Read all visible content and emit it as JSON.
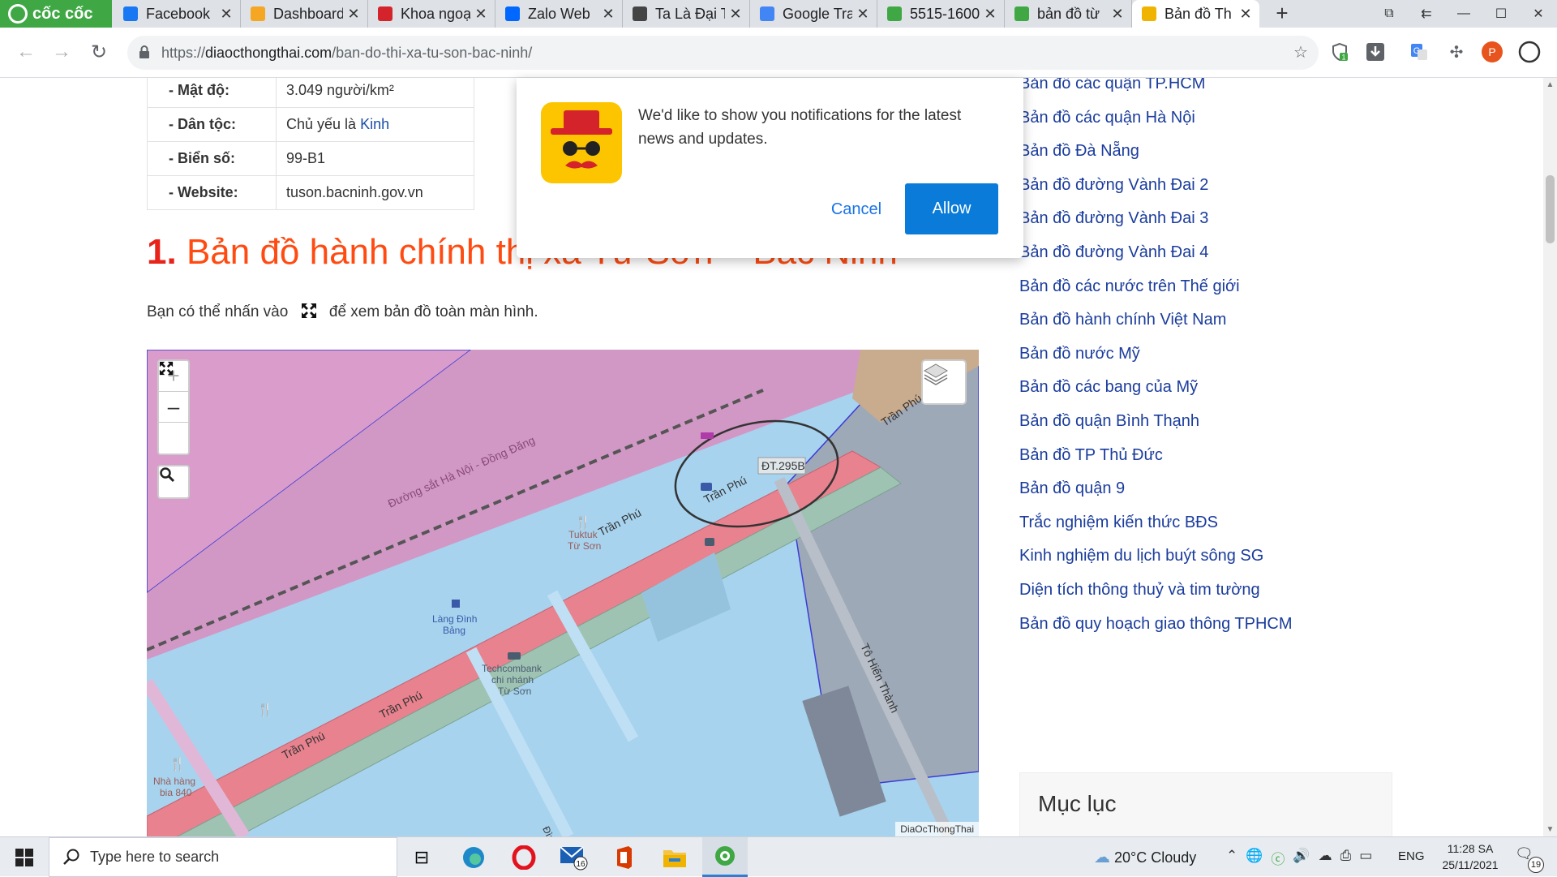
{
  "browser": {
    "brand": "cốc cốc",
    "tabs": [
      {
        "title": "Facebook",
        "favicon_color": "#1877f2"
      },
      {
        "title": "Dashboard",
        "favicon_color": "#f5a623"
      },
      {
        "title": "Khoa ngoại",
        "favicon_color": "#d4232a"
      },
      {
        "title": "Zalo Web",
        "favicon_color": "#0068ff"
      },
      {
        "title": "Ta Là Đại T",
        "favicon_color": "#444444"
      },
      {
        "title": "Google Tra",
        "favicon_color": "#4285f4"
      },
      {
        "title": "5515-1600",
        "favicon_color": "#3fa845"
      },
      {
        "title": "bản đồ từ",
        "favicon_color": "#3fa845"
      },
      {
        "title": "Bản đồ Th",
        "favicon_color": "#f0b400",
        "active": true
      }
    ],
    "url_prefix": "https://",
    "url_host": "diaocthongthai.com",
    "url_path": "/ban-do-thi-xa-tu-son-bac-ninh/",
    "extension_badge": "1",
    "profile_initial": "P"
  },
  "info_table": [
    {
      "key": "- Mật độ:",
      "value": "3.049 người/km²"
    },
    {
      "key": "- Dân tộc:",
      "value_prefix": "Chủ yếu là ",
      "value_link": "Kinh"
    },
    {
      "key": "- Biển số:",
      "value": "99-B1"
    },
    {
      "key": "- Website:",
      "value": "tuson.bacninh.gov.vn"
    }
  ],
  "heading": {
    "number": "1.",
    "text": "Bản đồ hành chính thị xã Từ Sơn – Bắc Ninh"
  },
  "intro": {
    "before": "Bạn có thể nhấn vào",
    "after": "để xem bản đồ toàn màn hình."
  },
  "map": {
    "zoom_in": "+",
    "zoom_out": "–",
    "attribution": "DiaOcThongThai",
    "labels": {
      "railway": "Đường sắt Hà Nội - Đồng Đăng",
      "road_main": "Trần Phú",
      "road_dt": "ĐT.295B",
      "road_to_hien_thanh": "Tô Hiến Thành",
      "poi_tuktuk": "Tuktuk\nTừ Sơn",
      "poi_lang": "Làng Đình\nBảng",
      "poi_techcombank_1": "Techcombank",
      "poi_techcombank_2": "chi nhánh",
      "poi_techcombank_3": "Từ Sơn",
      "poi_nhahang_1": "Nhà hàng",
      "poi_nhahang_2": "bia 840",
      "road_din": "Đìn"
    }
  },
  "sidebar": {
    "links": [
      "Bản đồ các quận TP.HCM",
      "Bản đồ các quận Hà Nội",
      "Bản đồ Đà Nẵng",
      "Bản đồ đường Vành Đai 2",
      "Bản đồ đường Vành Đai 3",
      "Bản đồ đường Vành Đai 4",
      "Bản đồ các nước trên Thế giới",
      "Bản đồ hành chính Việt Nam",
      "Bản đồ nước Mỹ",
      "Bản đồ các bang của Mỹ",
      "Bản đồ quận Bình Thạnh",
      "Bản đồ TP Thủ Đức",
      "Bản đồ quận 9",
      "Trắc nghiệm kiến thức BĐS",
      "Kinh nghiệm du lịch buýt sông SG",
      "Diện tích thông thuỷ và tim tường",
      "Bản đồ quy hoạch giao thông TPHCM"
    ],
    "toc_title": "Mục lục"
  },
  "notification": {
    "message": "We'd like to show you notifications for the latest news and updates.",
    "cancel": "Cancel",
    "allow": "Allow"
  },
  "taskbar": {
    "search_placeholder": "Type here to search",
    "mail_badge": "16",
    "weather": "20°C  Cloudy",
    "language": "ENG",
    "time": "11:28 SA",
    "date": "25/11/2021",
    "notification_count": "19"
  }
}
